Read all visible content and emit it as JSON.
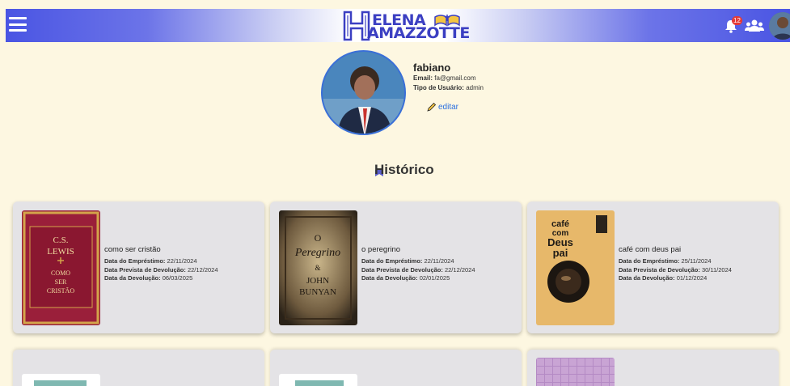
{
  "header": {
    "logo_line1": "ELENA",
    "logo_line2": "AMAZZOTTE",
    "notification_count": "12",
    "menu_icon": "hamburger-icon",
    "bell_icon": "bell-icon",
    "users_icon": "users-icon"
  },
  "profile": {
    "name": "fabiano",
    "email_label": "Email:",
    "email": "fa@gmail.com",
    "type_label": "Tipo de Usuário:",
    "type": "admin",
    "edit_label": "editar"
  },
  "history_title": "Histórico",
  "labels": {
    "loan": "Data do Empréstimo:",
    "due": "Data Prevista de Devolução:",
    "returned": "Data da Devolução:"
  },
  "books": [
    {
      "title": "como ser cristão",
      "loan": "22/11/2024",
      "due": "22/12/2024",
      "returned": "06/03/2025",
      "cover": {
        "author": "C.S. LEWIS",
        "line1": "COMO",
        "line2": "SER",
        "line3": "CRISTÃO"
      }
    },
    {
      "title": "o peregrino",
      "loan": "22/11/2024",
      "due": "22/12/2024",
      "returned": "02/01/2025",
      "cover": {
        "o": "O",
        "main": "Peregrino",
        "amp": "&",
        "author1": "JOHN",
        "author2": "BUNYAN"
      }
    },
    {
      "title": "café com deus pai",
      "loan": "25/11/2024",
      "due": "30/11/2024",
      "returned": "01/12/2024",
      "cover": {
        "l1": "café",
        "l2": "com",
        "l3": "Deus",
        "l4": "pai"
      }
    }
  ],
  "colors": {
    "background": "#fdf7e1",
    "header_blue": "#4a55e3",
    "card": "#e4e3e6",
    "link": "#2a6fe0",
    "badge": "#e53935"
  }
}
